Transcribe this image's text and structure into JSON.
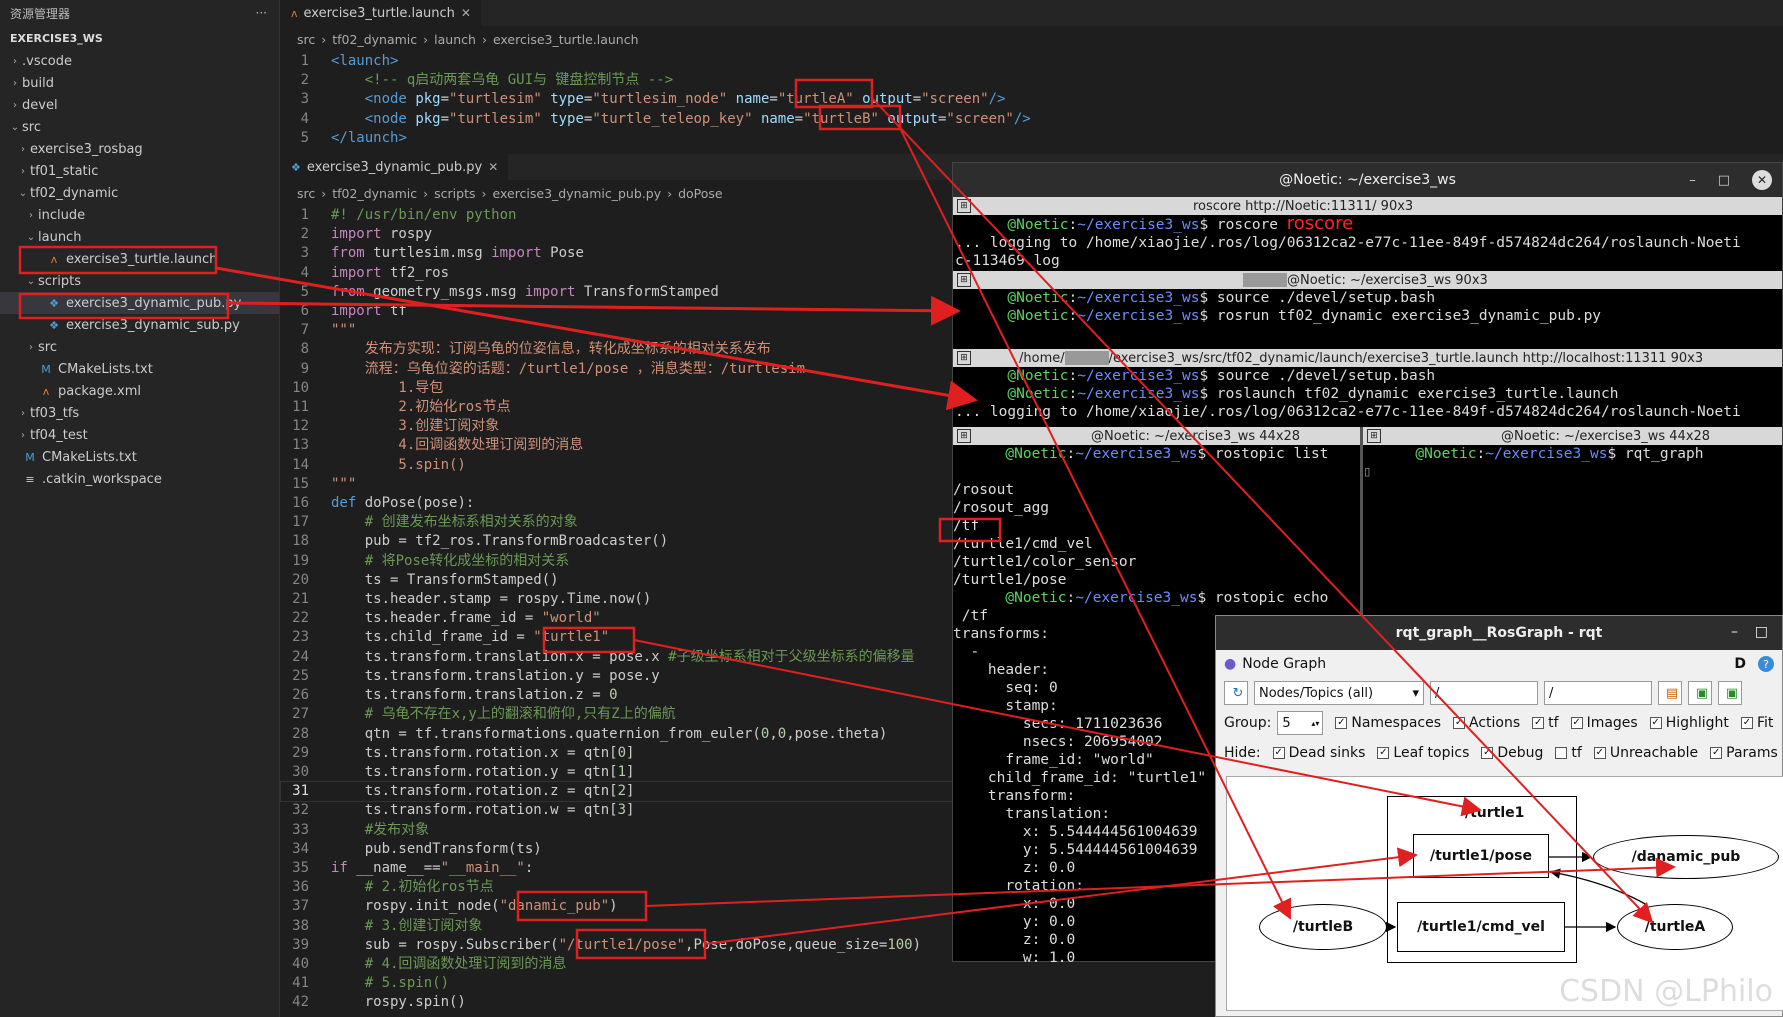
{
  "sidebar": {
    "title": "资源管理器",
    "more": "···",
    "workspace": "EXERCISE3_WS",
    "items": [
      {
        "label": ".vscode",
        "chev": "›",
        "icon": ""
      },
      {
        "label": "build",
        "chev": "›",
        "icon": ""
      },
      {
        "label": "devel",
        "chev": "›",
        "icon": ""
      },
      {
        "label": "src",
        "chev": "⌄",
        "icon": ""
      },
      {
        "label": "exercise3_rosbag",
        "chev": "›",
        "icon": ""
      },
      {
        "label": "tf01_static",
        "chev": "›",
        "icon": ""
      },
      {
        "label": "tf02_dynamic",
        "chev": "⌄",
        "icon": ""
      },
      {
        "label": "include",
        "chev": "›",
        "icon": ""
      },
      {
        "label": "launch",
        "chev": "⌄",
        "icon": ""
      },
      {
        "label": "exercise3_turtle.launch",
        "chev": "",
        "icon": "ᴧ"
      },
      {
        "label": "scripts",
        "chev": "⌄",
        "icon": ""
      },
      {
        "label": "exercise3_dynamic_pub.py",
        "chev": "",
        "icon": "❖"
      },
      {
        "label": "exercise3_dynamic_sub.py",
        "chev": "",
        "icon": "❖"
      },
      {
        "label": "src",
        "chev": "›",
        "icon": ""
      },
      {
        "label": "CMakeLists.txt",
        "chev": "",
        "icon": "M"
      },
      {
        "label": "package.xml",
        "chev": "",
        "icon": "ᴧ"
      },
      {
        "label": "tf03_tfs",
        "chev": "›",
        "icon": ""
      },
      {
        "label": "tf04_test",
        "chev": "›",
        "icon": ""
      },
      {
        "label": "CMakeLists.txt",
        "chev": "",
        "icon": "M"
      },
      {
        "label": ".catkin_workspace",
        "chev": "",
        "icon": "≡"
      }
    ]
  },
  "editor1": {
    "tab": "exercise3_turtle.launch",
    "crumbs": [
      "src",
      "tf02_dynamic",
      "launch",
      "exercise3_turtle.launch"
    ],
    "lines": [
      "<launch>",
      "    <!-- q启动两套乌龟 GUI与 键盘控制节点 -->",
      "    <node pkg=\"turtlesim\" type=\"turtlesim_node\" name=\"turtleA\" output=\"screen\"/>",
      "    <node pkg=\"turtlesim\" type=\"turtle_teleop_key\" name=\"turtleB\" output=\"screen\"/>",
      "</launch>"
    ]
  },
  "editor2": {
    "tab": "exercise3_dynamic_pub.py",
    "crumbs": [
      "src",
      "tf02_dynamic",
      "scripts",
      "exercise3_dynamic_pub.py",
      "doPose"
    ],
    "current_line": 31,
    "lines": [
      "#! /usr/bin/env python",
      "import rospy",
      "from turtlesim.msg import Pose",
      "import tf2_ros",
      "from geometry_msgs.msg import TransformStamped",
      "import tf",
      "\"\"\"",
      "    发布方实现：订阅乌龟的位姿信息，转化成坐标系的相对关系发布",
      "    流程：乌龟位姿的话题：/turtle1/pose ，消息类型：/turtlesim",
      "        1.导包",
      "        2.初始化ros节点",
      "        3.创建订阅对象",
      "        4.回调函数处理订阅到的消息",
      "        5.spin()",
      "\"\"\"",
      "def doPose(pose):",
      "    # 创建发布坐标系相对关系的对象",
      "    pub = tf2_ros.TransformBroadcaster()",
      "    # 将Pose转化成坐标的相对关系",
      "    ts = TransformStamped()",
      "    ts.header.stamp = rospy.Time.now()",
      "    ts.header.frame_id = \"world\"",
      "    ts.child_frame_id = \"turtle1\"",
      "    ts.transform.translation.x = pose.x #子级坐标系相对于父级坐标系的偏移量",
      "    ts.transform.translation.y = pose.y",
      "    ts.transform.translation.z = 0",
      "    # 乌龟不存在x,y上的翻滚和俯仰,只有Z上的偏航",
      "    qtn = tf.transformations.quaternion_from_euler(0,0,pose.theta)",
      "    ts.transform.rotation.x = qtn[0]",
      "    ts.transform.rotation.y = qtn[1]",
      "    ts.transform.rotation.z = qtn[2]",
      "    ts.transform.rotation.w = qtn[3]",
      "    #发布对象",
      "    pub.sendTransform(ts)",
      "if __name__==\"__main__\":",
      "    # 2.初始化ros节点",
      "    rospy.init_node(\"danamic_pub\")",
      "    # 3.创建订阅对象",
      "    sub = rospy.Subscriber(\"/turtle1/pose\",Pose,doPose,queue_size=100)",
      "    # 4.回调函数处理订阅到的消息",
      "    # 5.spin()",
      "    rospy.spin()"
    ]
  },
  "terminal": {
    "title": "@Noetic: ~/exercise3_ws",
    "ctrl_min": "–",
    "ctrl_max": "□",
    "ctrl_close": "✕",
    "pane1": {
      "title": "roscore http://Noetic:11311/ 90x3",
      "prompt_user": "@Noetic",
      "path": "~/exercise3_ws",
      "cmd": "roscore",
      "note": "roscore",
      "lines": [
        "... logging to /home/xiaojie/.ros/log/06312ca2-e77c-11ee-849f-d574824dc264/roslaunch-Noeti",
        "c-113469.log"
      ]
    },
    "pane2": {
      "title": "@Noetic: ~/exercise3_ws 90x3",
      "cmds": [
        "source ./devel/setup.bash",
        "rosrun tf02_dynamic exercise3_dynamic_pub.py"
      ]
    },
    "pane3": {
      "title_a": "/home/",
      "title_b": "/exercise3_ws/src/tf02_dynamic/launch/exercise3_turtle.launch http://localhost:11311 90x3",
      "cmds": [
        "source ./devel/setup.bash",
        "roslaunch tf02_dynamic exercise3_turtle.launch"
      ],
      "log": "... logging to /home/xiaojie/.ros/log/06312ca2-e77c-11ee-849f-d574824dc264/roslaunch-Noeti"
    },
    "pane4": {
      "title": "@Noetic: ~/exercise3_ws 44x28",
      "cmd1": "rostopic list",
      "topics": [
        "/rosout",
        "/rosout_agg",
        "/tf",
        "/turtle1/cmd_vel",
        "/turtle1/color_sensor",
        "/turtle1/pose"
      ],
      "cmd2": "rostopic echo",
      "echo": [
        " /tf",
        "transforms:",
        "  -",
        "    header:",
        "      seq: 0",
        "      stamp:",
        "        secs: 1711023636",
        "        nsecs: 206954002",
        "      frame_id: \"world\"",
        "    child_frame_id: \"turtle1\"",
        "    transform:",
        "      translation:",
        "        x: 5.544444561004639",
        "        y: 5.544444561004639",
        "        z: 0.0",
        "      rotation:",
        "        x: 0.0",
        "        y: 0.0",
        "        z: 0.0",
        "        w: 1.0"
      ]
    },
    "pane5": {
      "title": "@Noetic: ~/exercise3_ws 44x28",
      "cmd": "rqt_graph"
    }
  },
  "rqt": {
    "title": "rqt_graph__RosGraph - rqt",
    "ctrl_min": "–",
    "ctrl_max": "□",
    "plugin": "Node Graph",
    "plugin_letter": "D",
    "help": "?",
    "refresh": "↻",
    "mode": "Nodes/Topics (all)",
    "filter1": "/",
    "filter2": "/",
    "group_label": "Group:",
    "group_value": "5",
    "group_opts": [
      "Namespaces",
      "Actions",
      "tf",
      "Images",
      "Highlight",
      "Fit"
    ],
    "hide_label": "Hide:",
    "hide_opts": [
      "Dead sinks",
      "Leaf topics",
      "Debug",
      "tf",
      "Unreachable",
      "Params"
    ],
    "nodes": {
      "turtle1": "/turtle1",
      "pose": "/turtle1/pose",
      "pub": "/danamic_pub",
      "turtleB": "/turtleB",
      "cmd_vel": "/turtle1/cmd_vel",
      "turtleA": "/turtleA"
    }
  },
  "watermark": "CSDN @LPhilo",
  "colors": {
    "annotation": "#e02020"
  }
}
